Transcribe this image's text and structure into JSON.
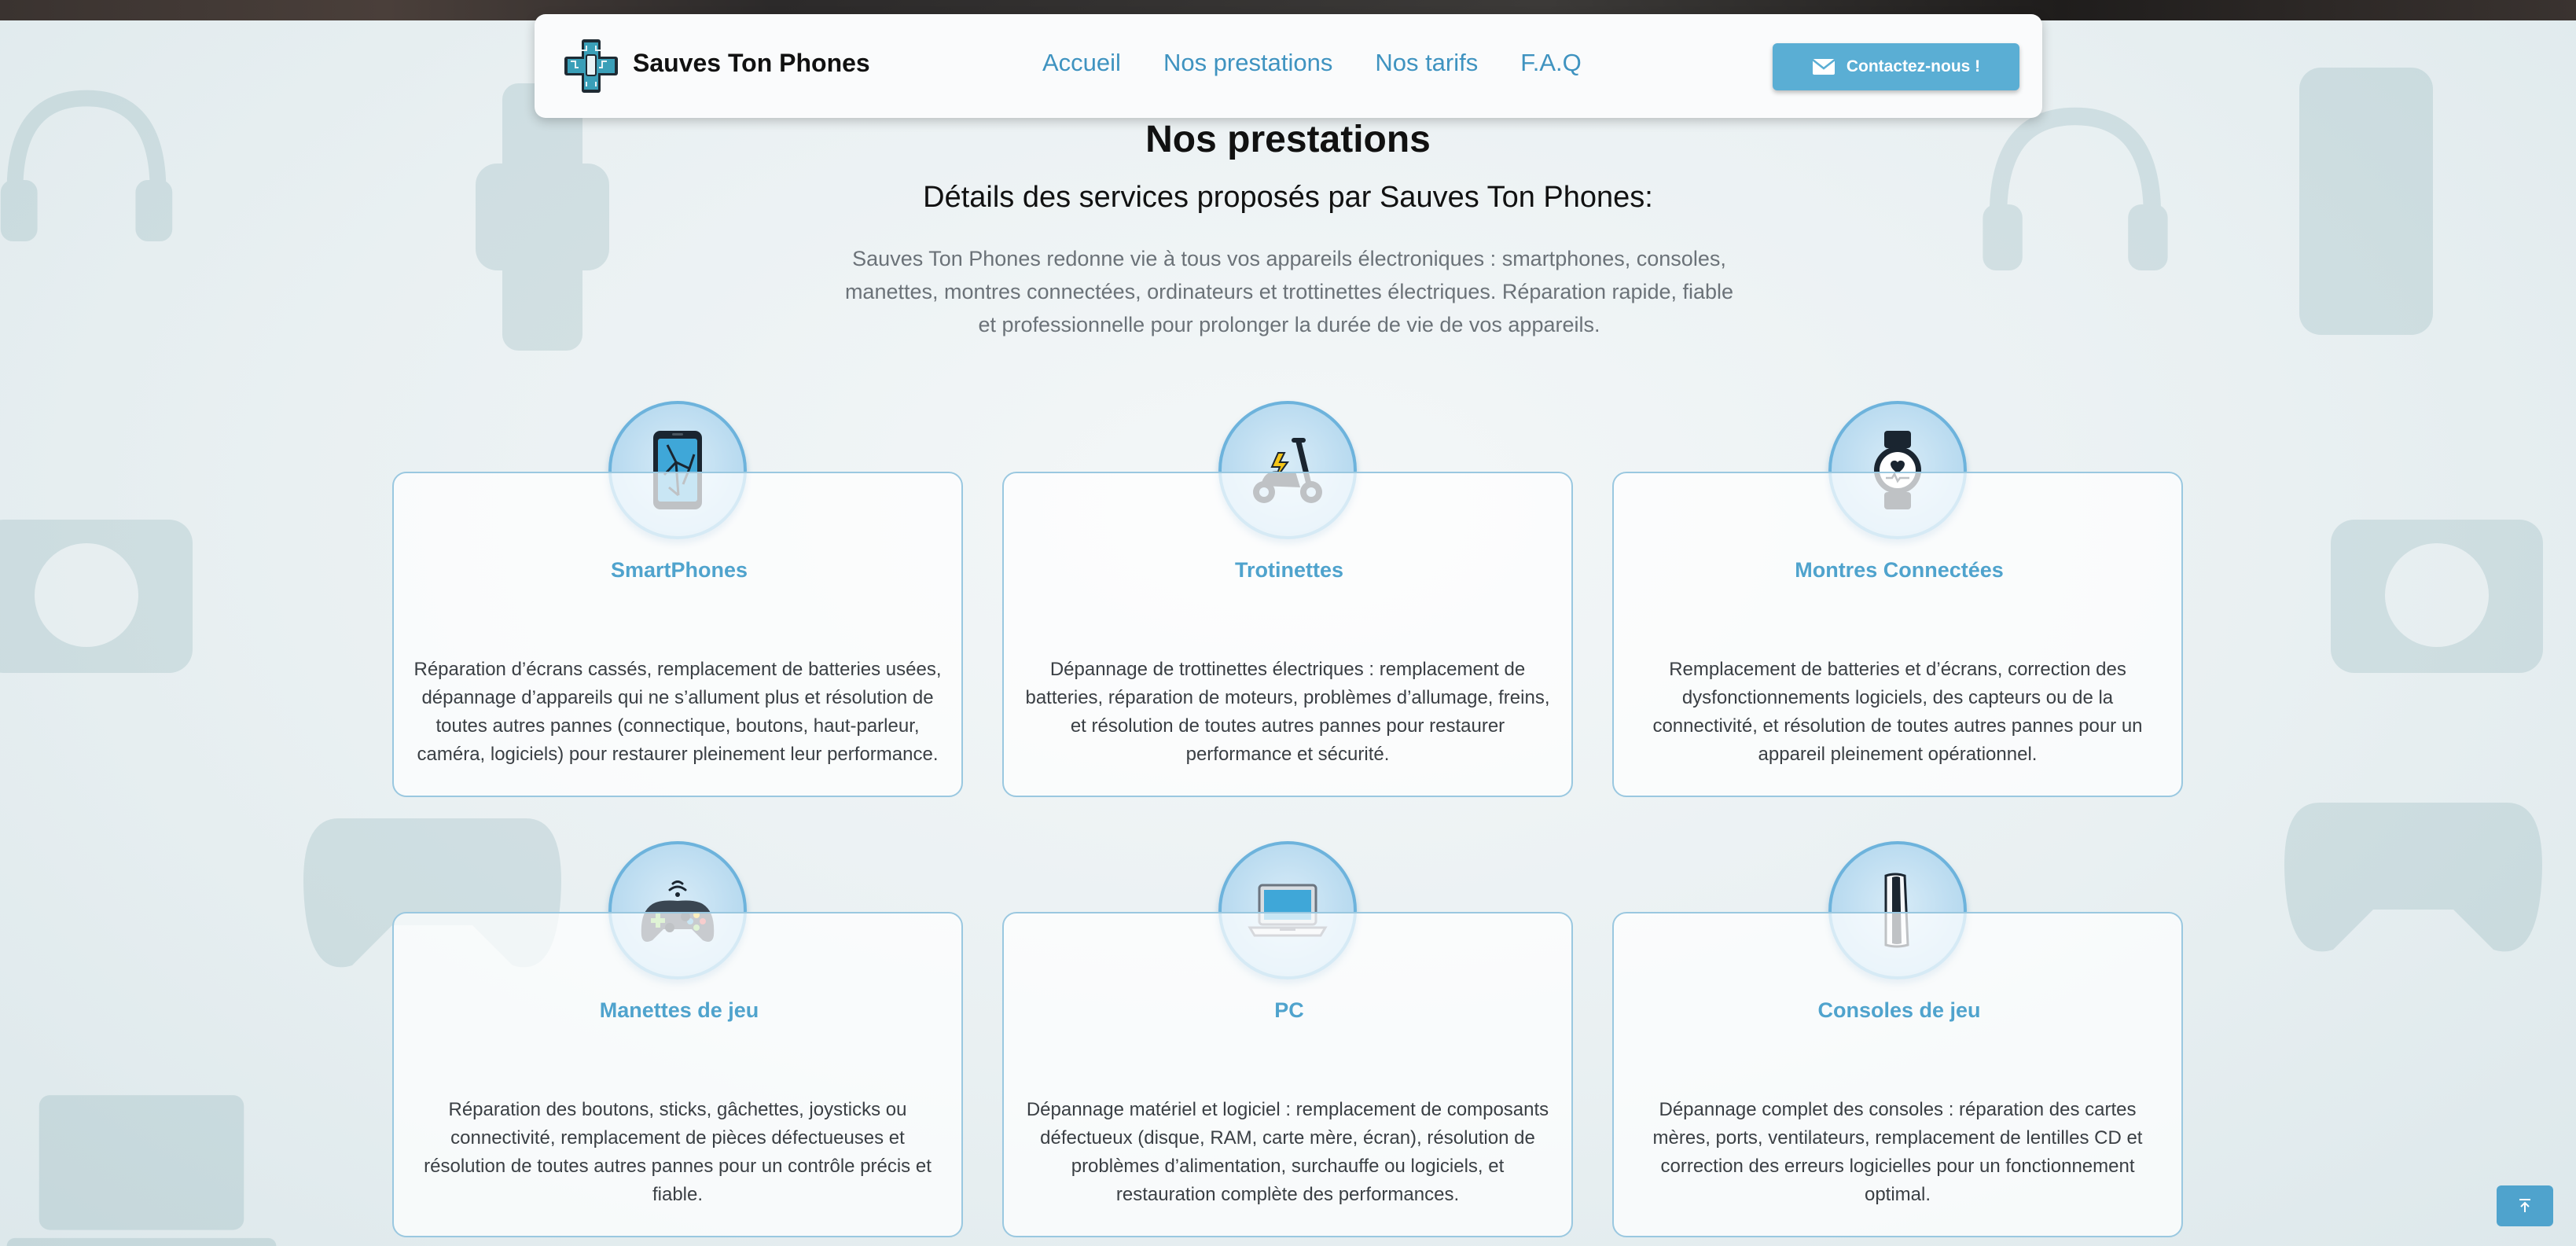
{
  "header": {
    "brand": "Sauves Ton Phones",
    "nav": [
      "Accueil",
      "Nos prestations",
      "Nos tarifs",
      "F.A.Q"
    ],
    "contact_label": "Contactez-nous !"
  },
  "main": {
    "title": "Nos prestations",
    "subtitle": "Détails des services proposés par Sauves Ton Phones:",
    "intro": "Sauves Ton Phones redonne vie à tous vos appareils électroniques : smartphones, consoles, manettes, montres connectées, ordinateurs et trottinettes électriques. Réparation rapide, fiable et professionnelle pour prolonger la durée de vie de vos appareils."
  },
  "services": [
    {
      "icon": "cracked-phone-icon",
      "title": "SmartPhones",
      "text": "Réparation d’écrans cassés, remplacement de batteries usées, dépannage d’appareils qui ne s’allument plus et résolution de toutes autres pannes (connectique, boutons, haut-parleur, caméra, logiciels) pour restaurer pleinement leur performance."
    },
    {
      "icon": "electric-scooter-icon",
      "title": "Trotinettes",
      "text": "Dépannage de trottinettes électriques : remplacement de batteries, réparation de moteurs, problèmes d’allumage, freins, et résolution de toutes autres pannes pour restaurer performance et sécurité."
    },
    {
      "icon": "smartwatch-icon",
      "title": "Montres Connectées",
      "text": "Remplacement de batteries et d’écrans, correction des dysfonctionnements logiciels, des capteurs ou de la connectivité, et résolution de toutes autres pannes pour un appareil pleinement opérationnel."
    },
    {
      "icon": "gamepad-icon",
      "title": "Manettes de jeu",
      "text": "Réparation des boutons, sticks, gâchettes, joysticks ou connectivité, remplacement de pièces défectueuses et résolution de toutes autres pannes pour un contrôle précis et fiable."
    },
    {
      "icon": "laptop-icon",
      "title": "PC",
      "text": "Dépannage matériel et logiciel : remplacement de composants défectueux (disque, RAM, carte mère, écran), résolution de problèmes d’alimentation, surchauffe ou logiciels, et restauration complète des performances."
    },
    {
      "icon": "game-console-icon",
      "title": "Consoles de jeu",
      "text": "Dépannage complet des consoles : réparation des cartes mères, ports, ventilateurs, remplacement de lentilles CD et correction des erreurs logicielles pour un fonctionnement optimal."
    }
  ],
  "colors": {
    "accent": "#4fa3cd",
    "nav_link": "#3f93c0",
    "button": "#5aaed4",
    "card_border": "#9ac8e0"
  },
  "back_to_top_icon": "arrow-up-icon"
}
